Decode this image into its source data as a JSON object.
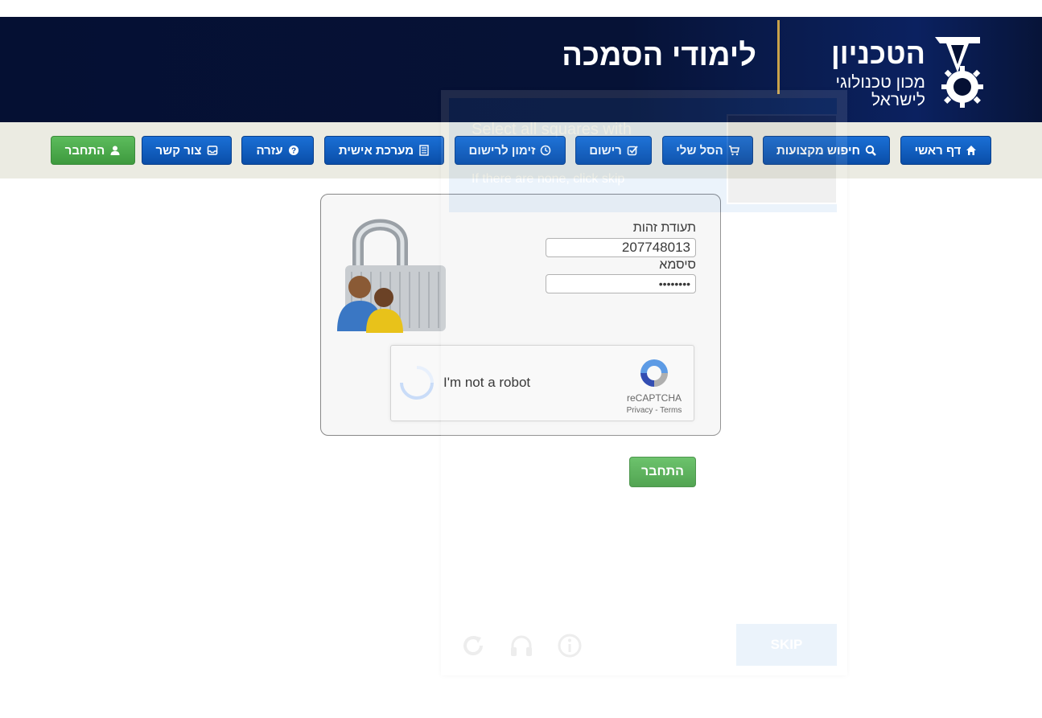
{
  "header": {
    "title": "לימודי הסמכה",
    "logo_main": "הטכניון",
    "logo_sub_line1": "מכון טכנולוגי",
    "logo_sub_line2": "לישראל"
  },
  "nav": {
    "home": "דף ראשי",
    "search_courses": "חיפוש מקצועות",
    "my_cart": "הסל שלי",
    "registration": "רישום",
    "registration_schedule": "זימון לרישום",
    "personal_system": "מערכת אישית",
    "help": "עזרה",
    "contact": "צור קשר",
    "login": "התחבר"
  },
  "login_form": {
    "id_label": "תעודת זהות",
    "id_value": "207748013",
    "password_label": "סיסמא",
    "password_value": "••••••••",
    "submit_label": "התחבר"
  },
  "recaptcha": {
    "checkbox_label": "I'm not a robot",
    "brand": "reCAPTCHA",
    "privacy": "Privacy",
    "separator": " - ",
    "terms": "Terms",
    "challenge_line1": "Select all squares with",
    "challenge_line2": "If there are none, click skip",
    "skip_label": "SKIP"
  },
  "colors": {
    "header_bg": "#051033",
    "nav_blue": "#0a4ea8",
    "nav_green": "#3e9a3e",
    "navbar_bg": "#ebebe2",
    "gold_divider": "#c9a24a"
  }
}
